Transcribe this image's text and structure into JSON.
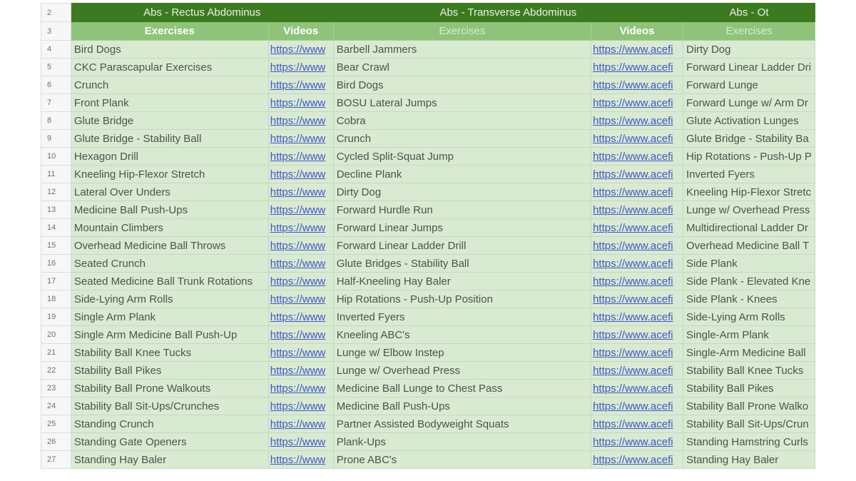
{
  "headers": {
    "row_number": "2",
    "groups": [
      "Abs - Rectus Abdominus",
      "Abs - Transverse Abdominus",
      "Abs - Ot"
    ]
  },
  "subheaders": {
    "row_number": "3",
    "labels": [
      "Exercises",
      "Videos",
      "Exercises",
      "Videos",
      "Exercises"
    ]
  },
  "rows": [
    {
      "n": "4",
      "a": "Bird Dogs",
      "av": "https://www",
      "b": "Barbell Jammers",
      "bv": "https://www.acefi",
      "c": "Dirty Dog"
    },
    {
      "n": "5",
      "a": "CKC Parascapular Exercises",
      "av": "https://www",
      "b": "Bear Crawl",
      "bv": "https://www.acefi",
      "c": "Forward Linear Ladder Dri"
    },
    {
      "n": "6",
      "a": "Crunch",
      "av": "https://www",
      "b": "Bird Dogs",
      "bv": "https://www.acefi",
      "c": "Forward Lunge"
    },
    {
      "n": "7",
      "a": "Front Plank",
      "av": "https://www",
      "b": "BOSU Lateral Jumps",
      "bv": "https://www.acefi",
      "c": "Forward Lunge w/ Arm Dr"
    },
    {
      "n": "8",
      "a": "Glute Bridge",
      "av": "https://www",
      "b": "Cobra",
      "bv": "https://www.acefi",
      "c": "Glute Activation Lunges"
    },
    {
      "n": "9",
      "a": "Glute Bridge - Stability Ball",
      "av": "https://www",
      "b": "Crunch",
      "bv": "https://www.acefi",
      "c": "Glute Bridge - Stability Ba"
    },
    {
      "n": "10",
      "a": "Hexagon Drill",
      "av": "https://www",
      "b": "Cycled Split-Squat Jump",
      "bv": "https://www.acefi",
      "c": "Hip Rotations - Push-Up P"
    },
    {
      "n": "11",
      "a": "Kneeling Hip-Flexor Stretch",
      "av": "https://www",
      "b": "Decline Plank",
      "bv": "https://www.acefi",
      "c": "Inverted Fyers"
    },
    {
      "n": "12",
      "a": "Lateral Over Unders",
      "av": "https://www",
      "b": "Dirty Dog",
      "bv": "https://www.acefi",
      "c": "Kneeling Hip-Flexor Stretc"
    },
    {
      "n": "13",
      "a": "Medicine Ball Push-Ups",
      "av": "https://www",
      "b": "Forward Hurdle Run",
      "bv": "https://www.acefi",
      "c": "Lunge w/ Overhead Press"
    },
    {
      "n": "14",
      "a": "Mountain Climbers",
      "av": "https://www",
      "b": "Forward Linear Jumps",
      "bv": "https://www.acefi",
      "c": "Multidirectional Ladder Dr"
    },
    {
      "n": "15",
      "a": "Overhead Medicine Ball Throws",
      "av": "https://www",
      "b": "Forward Linear Ladder Drill",
      "bv": "https://www.acefi",
      "c": "Overhead Medicine Ball T"
    },
    {
      "n": "16",
      "a": "Seated Crunch",
      "av": "https://www",
      "b": "Glute Bridges - Stability Ball",
      "bv": "https://www.acefi",
      "c": "Side Plank"
    },
    {
      "n": "17",
      "a": "Seated Medicine Ball Trunk Rotations",
      "av": "https://www",
      "b": "Half-Kneeling Hay Baler",
      "bv": "https://www.acefi",
      "c": "Side Plank - Elevated Kne"
    },
    {
      "n": "18",
      "a": "Side-Lying Arm Rolls",
      "av": "https://www",
      "b": "Hip Rotations - Push-Up Position",
      "bv": "https://www.acefi",
      "c": "Side Plank - Knees"
    },
    {
      "n": "19",
      "a": "Single Arm Plank",
      "av": "https://www",
      "b": "Inverted Fyers",
      "bv": "https://www.acefi",
      "c": "Side-Lying Arm Rolls"
    },
    {
      "n": "20",
      "a": "Single Arm Medicine Ball Push-Up",
      "av": "https://www",
      "b": "Kneeling ABC's",
      "bv": "https://www.acefi",
      "c": "Single-Arm Plank"
    },
    {
      "n": "21",
      "a": "Stability Ball Knee Tucks",
      "av": "https://www",
      "b": "Lunge w/ Elbow Instep",
      "bv": "https://www.acefi",
      "c": "Single-Arm Medicine Ball"
    },
    {
      "n": "22",
      "a": "Stability Ball Pikes",
      "av": "https://www",
      "b": "Lunge w/ Overhead Press",
      "bv": "https://www.acefi",
      "c": "Stability Ball Knee Tucks"
    },
    {
      "n": "23",
      "a": "Stability Ball Prone Walkouts",
      "av": "https://www",
      "b": "Medicine Ball Lunge to Chest Pass",
      "bv": "https://www.acefi",
      "c": "Stability Ball Pikes"
    },
    {
      "n": "24",
      "a": "Stability Ball Sit-Ups/Crunches",
      "av": "https://www",
      "b": "Medicine Ball Push-Ups",
      "bv": "https://www.acefi",
      "c": "Stability Ball Prone Walko"
    },
    {
      "n": "25",
      "a": "Standing Crunch",
      "av": "https://www",
      "b": "Partner Assisted Bodyweight Squats",
      "bv": "https://www.acefi",
      "c": "Stability Ball Sit-Ups/Crun"
    },
    {
      "n": "26",
      "a": "Standing Gate Openers",
      "av": "https://www",
      "b": "Plank-Ups",
      "bv": "https://www.acefi",
      "c": "Standing Hamstring Curls"
    },
    {
      "n": "27",
      "a": "Standing Hay Baler",
      "av": "https://www",
      "b": "Prone ABC's",
      "bv": "https://www.acefi",
      "c": "Standing Hay Baler"
    }
  ],
  "colors": {
    "group_header": "#3c7a1f",
    "column_header": "#8fc37a",
    "cell_background": "#d9ead3",
    "link": "#4057c8"
  }
}
